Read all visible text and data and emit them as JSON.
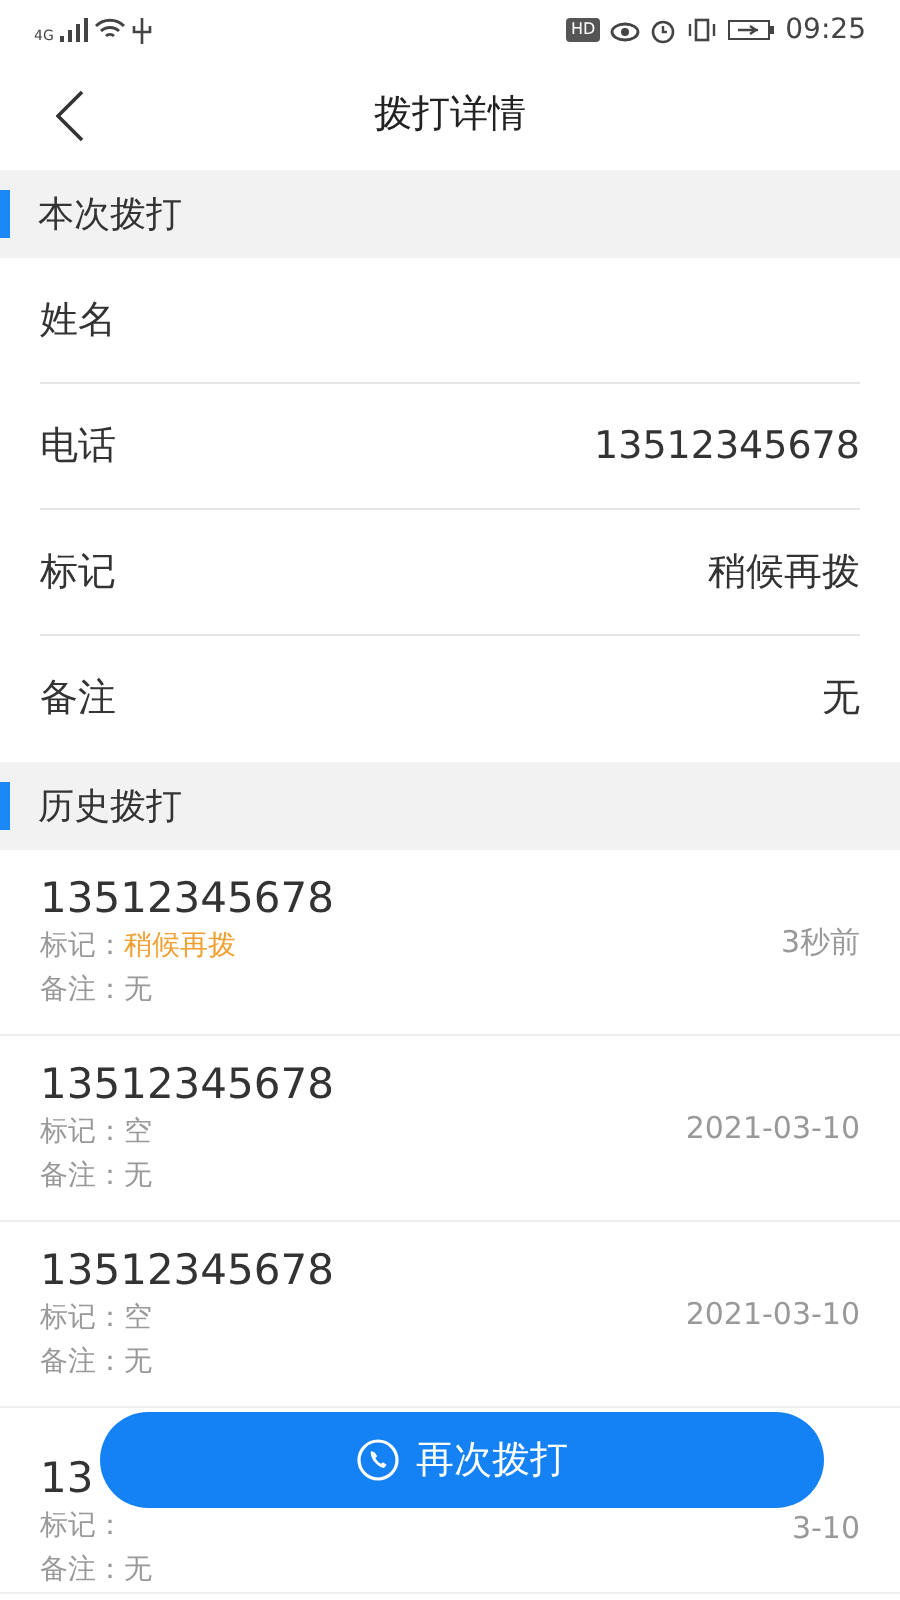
{
  "status_bar": {
    "network": "4G",
    "hd": "HD",
    "time": "09:25"
  },
  "header": {
    "title": "拨打详情"
  },
  "current_section": {
    "title": "本次拨打",
    "fields": [
      {
        "label": "姓名"
      },
      {
        "label": "电话",
        "value": "13512345678"
      },
      {
        "label": "标记",
        "value": "稍候再拨"
      },
      {
        "label": "备注",
        "value": "无"
      }
    ]
  },
  "history_section": {
    "title": "历史拨打",
    "items": [
      {
        "phone": "13512345678",
        "mark_label": "标记：",
        "mark_value": "稍候再拨",
        "color": "#f0a030",
        "remark": "备注：无",
        "time": "3秒前"
      },
      {
        "phone": "13512345678",
        "mark_label": "标记：",
        "mark_value": "空",
        "color": "#9a9a9a",
        "remark": "备注：无",
        "time": "2021-03-10"
      },
      {
        "phone": "13512345678",
        "mark_label": "标记：",
        "mark_value": "空",
        "color": "#9a9a9a",
        "remark": "备注：无",
        "time": "2021-03-10"
      },
      {
        "phone": "13",
        "mark_label": "标记：",
        "remark": "备注：无",
        "time": "3-10"
      }
    ]
  },
  "call_again_button": {
    "label": "再次拨打"
  }
}
